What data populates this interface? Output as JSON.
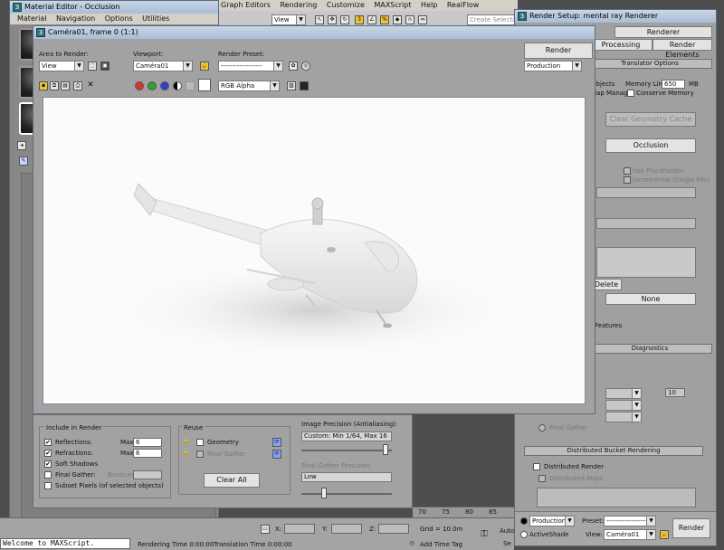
{
  "max_menu": {
    "items": [
      "Graph Editors",
      "Rendering",
      "Customize",
      "MAXScript",
      "Help",
      "RealFlow"
    ],
    "view_dropdown": "View",
    "create_selection": "Create Selection"
  },
  "material_editor": {
    "title": "Material Editor - Occlusion",
    "menu": [
      "Material",
      "Navigation",
      "Options",
      "Utilities"
    ]
  },
  "frame_window": {
    "title": "Caméra01, frame 0 (1:1)",
    "area_label": "Area to Render:",
    "area_value": "View",
    "viewport_label": "Viewport:",
    "viewport_value": "Caméra01",
    "preset_label": "Render Preset:",
    "preset_value": "------------------",
    "render_button": "Render",
    "production_value": "Production",
    "channel_value": "RGB Alpha",
    "include_title": "Include in Render",
    "reflections_label": "Reflections:",
    "reflections_max_label": "Max",
    "reflections_max": "6",
    "refractions_label": "Refractions:",
    "refractions_max_label": "Max",
    "refractions_max": "6",
    "soft_shadows_label": "Soft Shadows",
    "final_gather_label": "Final Gather:",
    "bounces_label": "Bounces",
    "subset_label": "Subset Pixels (of selected objects)",
    "reuse_title": "Reuse",
    "geometry_label": "Geometry",
    "final_gather_reuse_label": "Final Gather",
    "clear_all_button": "Clear All",
    "precision_title": "Image Precision (Antialiasing):",
    "precision_value": "Custom: Min 1/64, Max 16",
    "fg_precision_label": "Final Gather Precision",
    "fg_precision_value": "Low"
  },
  "render_setup": {
    "title": "Render Setup: mental ray Renderer",
    "tabs": [
      "Renderer",
      "Processing",
      "Render Elements"
    ],
    "translator_rollout": "Translator Options",
    "objects_label": "Objects",
    "memory_limit_label": "Memory Limit:",
    "memory_limit_value": "650",
    "memory_unit": "MB",
    "map_manager_label": "Map Manager",
    "conserve_memory_label": "Conserve Memory",
    "clear_geometry_cache": "Clear Geometry Cache",
    "occlusion_button": "Occlusion",
    "use_placeholder_label": "Use Placeholder",
    "incremental_label": "Incremental (Single File)",
    "delete_button": "Delete",
    "none_button": "None",
    "features_label": "Features",
    "diagnostics_rollout": "Diagnostics",
    "spinner_value": "10",
    "final_gather_label": "Final Gather",
    "dbr_rollout": "Distributed Bucket Rendering",
    "distributed_render_label": "Distributed Render",
    "distributed_maps_label": "Distributed Maps",
    "production_value": "Production",
    "preset_label": "Preset:",
    "preset_value": "------------------",
    "activeshade_label": "ActiveShade",
    "view_label": "View:",
    "view_value": "Caméra01",
    "render_button": "Render"
  },
  "status_bar": {
    "maxscript_prompt": "Welcome to MAXScript.",
    "rendering_time": "Rendering Time  0:00:00",
    "translation_time": "Translation Time  0:00:00",
    "x_label": "X:",
    "y_label": "Y:",
    "z_label": "Z:",
    "grid": "Grid = 10.0m",
    "add_time_tag": "Add Time Tag",
    "timeline_ticks": [
      "70",
      "75",
      "80",
      "85"
    ],
    "auto_label": "Auto",
    "set_label": "Se"
  }
}
